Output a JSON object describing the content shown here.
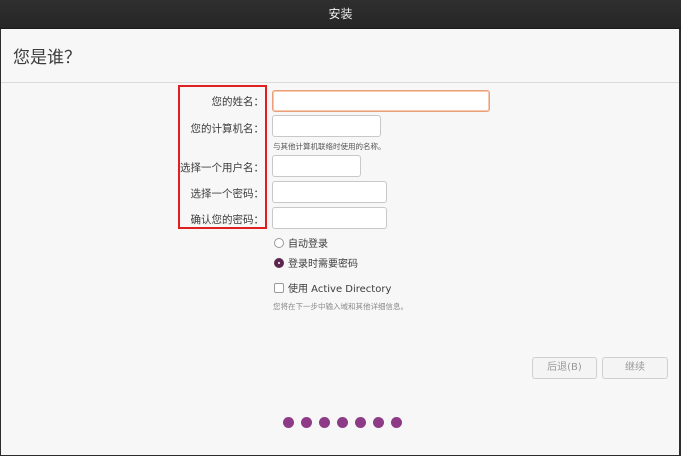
{
  "window": {
    "title": "安装"
  },
  "page": {
    "title": "您是谁？"
  },
  "form": {
    "name_label": "您的姓名：",
    "name_value": "",
    "computer_label": "您的计算机名：",
    "computer_value": "",
    "computer_hint": "与其他计算机联络时使用的名称。",
    "username_label": "选择一个用户名：",
    "username_value": "",
    "password_label": "选择一个密码：",
    "password_value": "",
    "confirm_label": "确认您的密码：",
    "confirm_value": ""
  },
  "login": {
    "auto_label": "自动登录",
    "auto_selected": false,
    "require_label": "登录时需要密码",
    "require_selected": true
  },
  "ad": {
    "label": "使用 Active Directory",
    "checked": false,
    "hint": "您将在下一步中输入域和其他详细信息。"
  },
  "buttons": {
    "back": "后退(B)",
    "continue": "继续"
  },
  "progress": {
    "total_steps": 7,
    "dot_color": "#8d3a87"
  },
  "colors": {
    "accent": "#5e2750",
    "focus_border": "#e9a07a",
    "highlight_box": "#e02020"
  }
}
